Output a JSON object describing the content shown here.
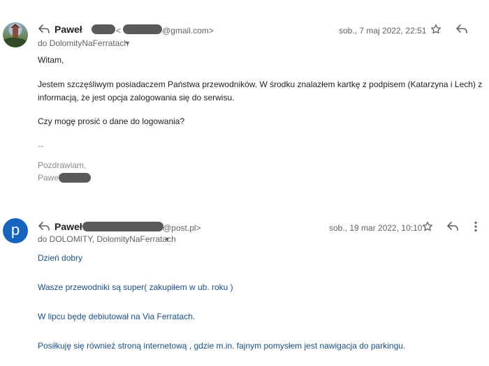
{
  "message1": {
    "sender_name": "Paweł",
    "email_prefix": "<",
    "email_suffix": "@gmail.com>",
    "date": "sob., 7 maj 2022, 22:51",
    "to": "do DolomityNaFerratach",
    "greeting": "Witam,",
    "paragraph_line1": "Jestem szczęśliwym posiadaczem Państwa przewodników. W środku znalazłem kartkę z podpisem (Katarzyna i Lech) z",
    "paragraph_line2": "informacją, że jest opcja zalogowania się do serwisu.",
    "question": "Czy mogę prosić o dane do logowania?",
    "separator": "--",
    "closing": "Pozdrawiam,",
    "signature_name": "Paweł"
  },
  "message2": {
    "avatar_letter": "p",
    "sender_name": "Paweł",
    "email_suffix": "@post.pl>",
    "date": "sob., 19 mar 2022, 10:10",
    "to": "do DOLOMITY, DolomityNaFerratach",
    "line1": "Dzień dobry",
    "line2": "Wasze przewodniki są super( zakupiłem w ub. roku )",
    "line3": "W lipcu będę debiutował na Via Ferratach.",
    "line4": "Posiłkuję się również stroną internetową , gdzie m.in. fajnym pomysłem jest nawigacja do parkingu."
  },
  "icons": {
    "reply": "reply-icon",
    "star": "star-icon",
    "more": "more-vert-icon",
    "caret": "caret-down-icon"
  },
  "colors": {
    "avatar_p": "#1565c0",
    "body2_text": "#1a4f8b",
    "redaction": "#5a5a5a"
  }
}
